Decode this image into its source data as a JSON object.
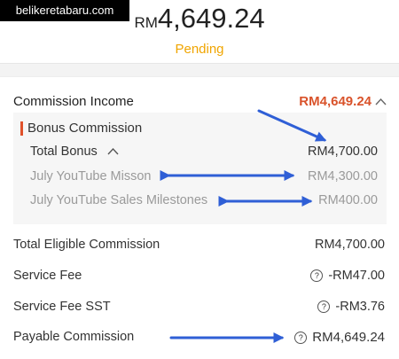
{
  "watermark": "belikeretabaru.com",
  "summary": {
    "currency": "RM",
    "amount": "4,649.24",
    "status": "Pending"
  },
  "commission_income": {
    "label": "Commission Income",
    "value": "RM4,649.24"
  },
  "bonus": {
    "title": "Bonus Commission",
    "total_label": "Total Bonus",
    "total_value": "RM4,700.00",
    "items": [
      {
        "label": "July YouTube Misson",
        "value": "RM4,300.00"
      },
      {
        "label": "July YouTube Sales Milestones",
        "value": "RM400.00"
      }
    ]
  },
  "breakdown": [
    {
      "label": "Total Eligible Commission",
      "value": "RM4,700.00"
    },
    {
      "label": "Service Fee",
      "value": "-RM47.00"
    },
    {
      "label": "Service Fee SST",
      "value": "-RM3.76"
    },
    {
      "label": "Payable Commission",
      "value": "RM4,649.24"
    }
  ],
  "icons": {
    "chevron": "chevron-up-icon",
    "help": "question-circle-icon"
  },
  "colors": {
    "accent": "#d9532b",
    "status": "#f0a500",
    "annotation": "#2f5fd6"
  }
}
